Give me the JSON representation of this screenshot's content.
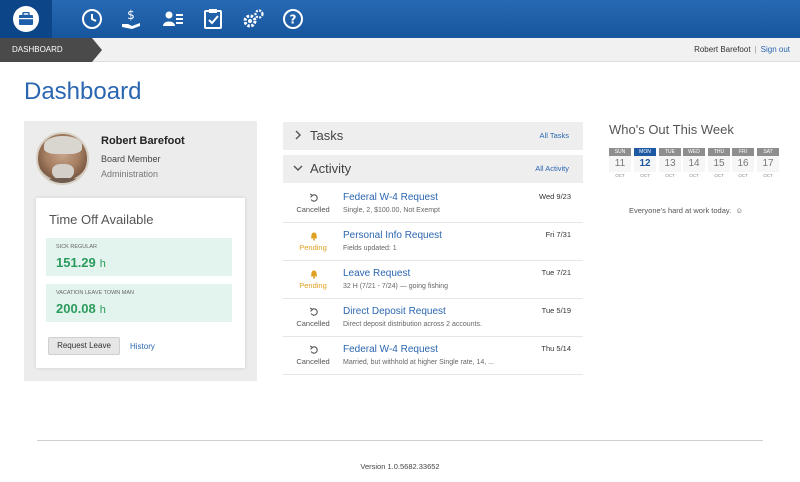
{
  "nav": {
    "icons": [
      "briefcase-icon",
      "clock-icon",
      "payroll-hand-icon",
      "employee-card-icon",
      "checklist-icon",
      "gears-icon",
      "help-icon"
    ]
  },
  "breadcrumb": {
    "label": "DASHBOARD"
  },
  "user": {
    "name": "Robert Barefoot",
    "signout": "Sign out"
  },
  "page": {
    "title": "Dashboard"
  },
  "profile": {
    "name": "Robert Barefoot",
    "role": "Board Member",
    "department": "Administration"
  },
  "timeoff": {
    "title": "Time Off Available",
    "balances": [
      {
        "label": "SICK REGULAR",
        "value": "151.29",
        "unit": "h"
      },
      {
        "label": "VACATION LEAVE TOWN MAN",
        "value": "200.08",
        "unit": "h"
      }
    ],
    "request_label": "Request Leave",
    "history_label": "History"
  },
  "tasks": {
    "title": "Tasks",
    "link": "All Tasks"
  },
  "activity": {
    "title": "Activity",
    "link": "All Activity",
    "items": [
      {
        "status": "Cancelled",
        "title": "Federal W-4 Request",
        "desc": "Single, 2, $100.00, Not Exempt",
        "date": "Wed 9/23"
      },
      {
        "status": "Pending",
        "title": "Personal Info Request",
        "desc": "Fields updated: 1",
        "date": "Fri 7/31"
      },
      {
        "status": "Pending",
        "title": "Leave Request",
        "desc": "32 H (7/21 - 7/24) — going fishing",
        "date": "Tue 7/21"
      },
      {
        "status": "Cancelled",
        "title": "Direct Deposit Request",
        "desc": "Direct deposit distribution across 2 accounts.",
        "date": "Tue 5/19"
      },
      {
        "status": "Cancelled",
        "title": "Federal W-4 Request",
        "desc": "Married, but withhold at higher Single rate, 14, ...",
        "date": "Thu 5/14"
      }
    ]
  },
  "whos_out": {
    "title": "Who's Out This Week",
    "days": [
      {
        "dow": "SUN",
        "num": "11",
        "mon": "OCT"
      },
      {
        "dow": "MON",
        "num": "12",
        "mon": "OCT"
      },
      {
        "dow": "TUE",
        "num": "13",
        "mon": "OCT"
      },
      {
        "dow": "WED",
        "num": "14",
        "mon": "OCT"
      },
      {
        "dow": "THU",
        "num": "15",
        "mon": "OCT"
      },
      {
        "dow": "FRI",
        "num": "16",
        "mon": "OCT"
      },
      {
        "dow": "SAT",
        "num": "17",
        "mon": "OCT"
      }
    ],
    "empty_text": "Everyone's hard at work today.",
    "empty_icon": "☺"
  },
  "footer": {
    "version": "Version 1.0.5682.33652"
  },
  "colors": {
    "nav": "#1d5fa8",
    "link": "#2b66b1",
    "pending": "#e0a020",
    "balance": "#2b9b5c"
  }
}
